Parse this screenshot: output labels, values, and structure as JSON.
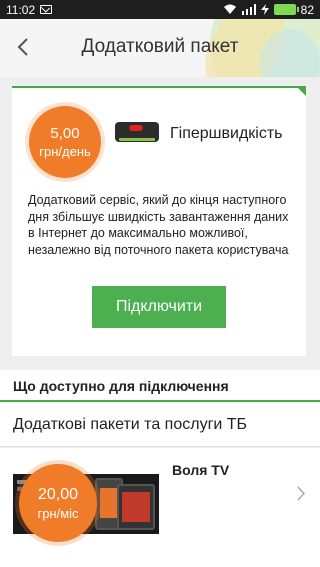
{
  "status_bar": {
    "time": "11:02",
    "battery": "82"
  },
  "header": {
    "back_icon": "chevron-left-icon",
    "title": "Додатковий пакет"
  },
  "card": {
    "price_amount": "5,00",
    "price_unit": "грн/день",
    "service_icon": "router-icon",
    "service_name": "Гіпершвидкість",
    "description": "Додатковий сервіс, який до кінця наступного дня збільшує швидкість завантаження даних в Інтернет до максимально можливої, незалежно від поточного пакета користувача",
    "connect_label": "Підключити"
  },
  "section_available": {
    "title": "Що доступно для підключення"
  },
  "section_tv": {
    "title": "Додаткові пакети та послуги ТБ"
  },
  "items": [
    {
      "price_amount": "20,00",
      "price_unit": "грн/міс",
      "title": "Воля TV"
    }
  ],
  "colors": {
    "accent_green": "#4caf50",
    "price_orange": "#f07c2a"
  }
}
